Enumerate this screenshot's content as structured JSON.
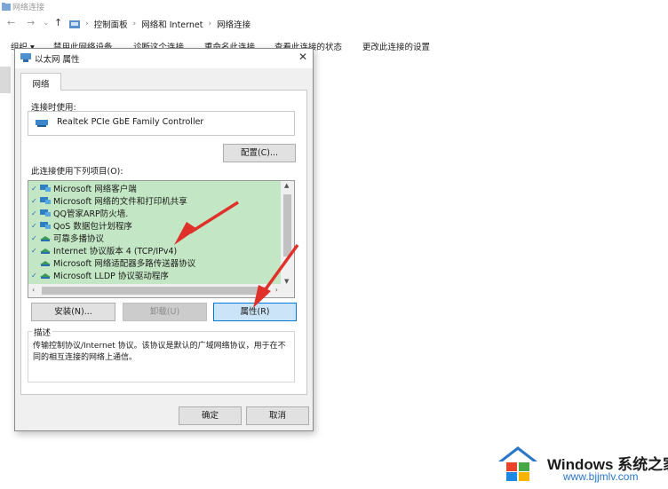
{
  "explorer": {
    "window_title": "网络连接",
    "breadcrumb": [
      "控制面板",
      "网络和 Internet",
      "网络连接"
    ],
    "toolbar": [
      "组织 ▾",
      "禁用此网络设备",
      "诊断这个连接",
      "重命名此连接",
      "查看此连接的状态",
      "更改此连接的设置"
    ]
  },
  "dialog": {
    "title": "以太网 属性",
    "tab_label": "网络",
    "connect_using_label": "连接时使用:",
    "adapter_name": "Realtek PCIe GbE Family Controller",
    "configure_button": "配置(C)...",
    "items_label": "此连接使用下列项目(O):",
    "items": [
      {
        "label": "Microsoft 网络客户端",
        "checked": true,
        "icon": "network-client-icon"
      },
      {
        "label": "Microsoft 网络的文件和打印机共享",
        "checked": true,
        "icon": "network-share-icon"
      },
      {
        "label": "QQ管家ARP防火墙.",
        "checked": true,
        "icon": "firewall-icon"
      },
      {
        "label": "QoS 数据包计划程序",
        "checked": true,
        "icon": "qos-icon"
      },
      {
        "label": "可靠多播协议",
        "checked": true,
        "icon": "protocol-icon"
      },
      {
        "label": "Internet 协议版本 4 (TCP/IPv4)",
        "checked": true,
        "icon": "protocol-icon"
      },
      {
        "label": "Microsoft 网络适配器多路传送器协议",
        "checked": false,
        "icon": "protocol-icon"
      },
      {
        "label": "Microsoft LLDP 协议驱动程序",
        "checked": true,
        "icon": "protocol-icon"
      }
    ],
    "install_button": "安装(N)...",
    "uninstall_button": "卸载(U)",
    "properties_button": "属性(R)",
    "description_title": "描述",
    "description_text": "传输控制协议/Internet 协议。该协议是默认的广域网络协议，用于在不同的相互连接的网络上通信。",
    "ok_button": "确定",
    "cancel_button": "取消"
  },
  "watermark": {
    "brand": "Windows 系统之家",
    "url": "www.bjjmlv.com"
  },
  "colors": {
    "selection_green": "#c3e6c4",
    "arrow_red": "#e0302a",
    "accent_blue": "#0078d7"
  }
}
